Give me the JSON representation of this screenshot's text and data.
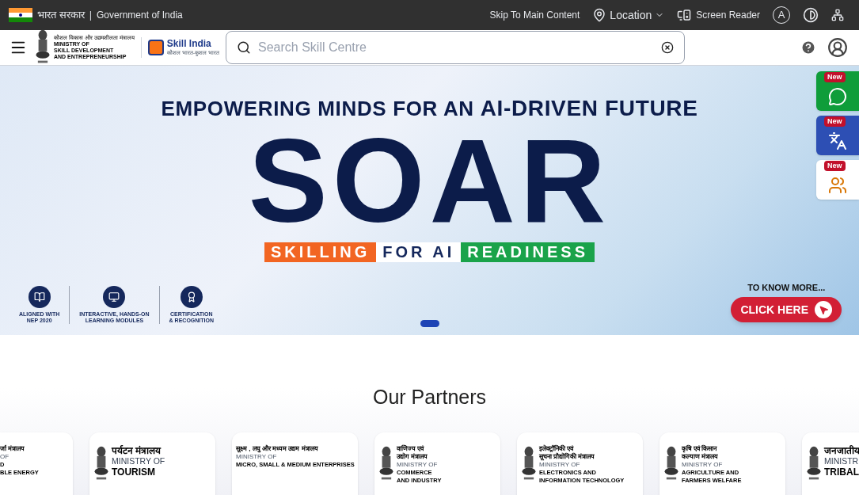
{
  "gov_bar": {
    "hindi": "भारत सरकार",
    "separator": "|",
    "english": "Government of India",
    "links": [
      {
        "kind": "text",
        "label": "Skip To Main Content"
      },
      {
        "kind": "location",
        "label": "Location"
      },
      {
        "kind": "reader",
        "label": "Screen Reader"
      },
      {
        "kind": "font",
        "label": "A"
      },
      {
        "kind": "contrast"
      },
      {
        "kind": "sitemap"
      }
    ]
  },
  "header": {
    "ministry_logo": {
      "hindi": "कौशल विकास और उद्यमशीलता मंत्रालय",
      "lines": [
        "MINISTRY OF",
        "SKILL DEVELOPMENT",
        "AND ENTREPRENEURSHIP"
      ]
    },
    "skill_logo": {
      "name": "Skill India",
      "tagline": "कौशल भारत-कुशल भारत"
    },
    "search": {
      "placeholder": "Search Skill Centre"
    }
  },
  "banner": {
    "headline_lead": "EMPOWERING MINDS FOR AN",
    "headline_bold": "AI-DRIVEN FUTURE",
    "title": "SOAR",
    "tagline": [
      {
        "text": "SKILLING",
        "color": "#f26522"
      },
      {
        "text": "FOR AI",
        "color": "#ffffff"
      },
      {
        "text": "READINESS",
        "color": "#1aa34a"
      }
    ],
    "features": [
      {
        "kind": "book",
        "lines": [
          "ALIGNED WITH",
          "NEP 2020"
        ]
      },
      {
        "kind": "monitor",
        "lines": [
          "INTERACTIVE, HANDS-ON",
          "LEARNING MODULES"
        ]
      },
      {
        "kind": "badge",
        "lines": [
          "CERTIFICATION",
          "& RECOGNITION"
        ]
      }
    ],
    "cta_lead": "TO KNOW MORE...",
    "cta": "CLICK HERE",
    "slides": [
      {
        "selected": true
      }
    ]
  },
  "side_tabs": [
    {
      "kind": "whatsapp",
      "badge": "New",
      "color": "#0f9d3a"
    },
    {
      "kind": "translate",
      "badge": "New",
      "color": "#2d4fb4"
    },
    {
      "kind": "meeting",
      "badge": "New",
      "color": "#ffffff"
    }
  ],
  "partners": {
    "title": "Our Partners",
    "cards": [
      {
        "kind": "small",
        "emblem": false,
        "hindi": [
          "र्जा मंत्रालय"
        ],
        "ministry": "OF",
        "name": [
          "D",
          "BLE ENERGY"
        ]
      },
      {
        "kind": "large",
        "emblem": true,
        "hindi": [
          "पर्यटन मंत्रालय"
        ],
        "ministry": "MINISTRY OF",
        "name": [
          "TOURISM"
        ]
      },
      {
        "kind": "small",
        "emblem": false,
        "hindi": [
          "सूक्ष्म , लघु और मध्यम उद्यम मंत्रालय"
        ],
        "ministry": "MINISTRY OF",
        "name": [
          "MICRO, SMALL & MEDIUM ENTERPRISES"
        ]
      },
      {
        "kind": "small",
        "emblem": true,
        "hindi": [
          "वाणिज्य एवं",
          "उद्योग मंत्रालय"
        ],
        "ministry": "MINISTRY OF",
        "name": [
          "COMMERCE",
          "AND INDUSTRY"
        ]
      },
      {
        "kind": "small",
        "emblem": true,
        "hindi": [
          "इलेक्ट्रॉनिकी एवं",
          "सूचना प्रौद्योगिकी मंत्रालय"
        ],
        "ministry": "MINISTRY OF",
        "name": [
          "ELECTRONICS AND",
          "INFORMATION TECHNOLOGY"
        ]
      },
      {
        "kind": "small",
        "emblem": true,
        "hindi": [
          "कृषि एवं किसान",
          "कल्याण मंत्रालय"
        ],
        "ministry": "MINISTRY OF",
        "name": [
          "AGRICULTURE AND",
          "FARMERS WELFARE"
        ]
      },
      {
        "kind": "large",
        "emblem": true,
        "hindi": [
          "जनजातीय"
        ],
        "ministry": "MINISTR",
        "name": [
          "TRIBAL"
        ]
      }
    ]
  }
}
